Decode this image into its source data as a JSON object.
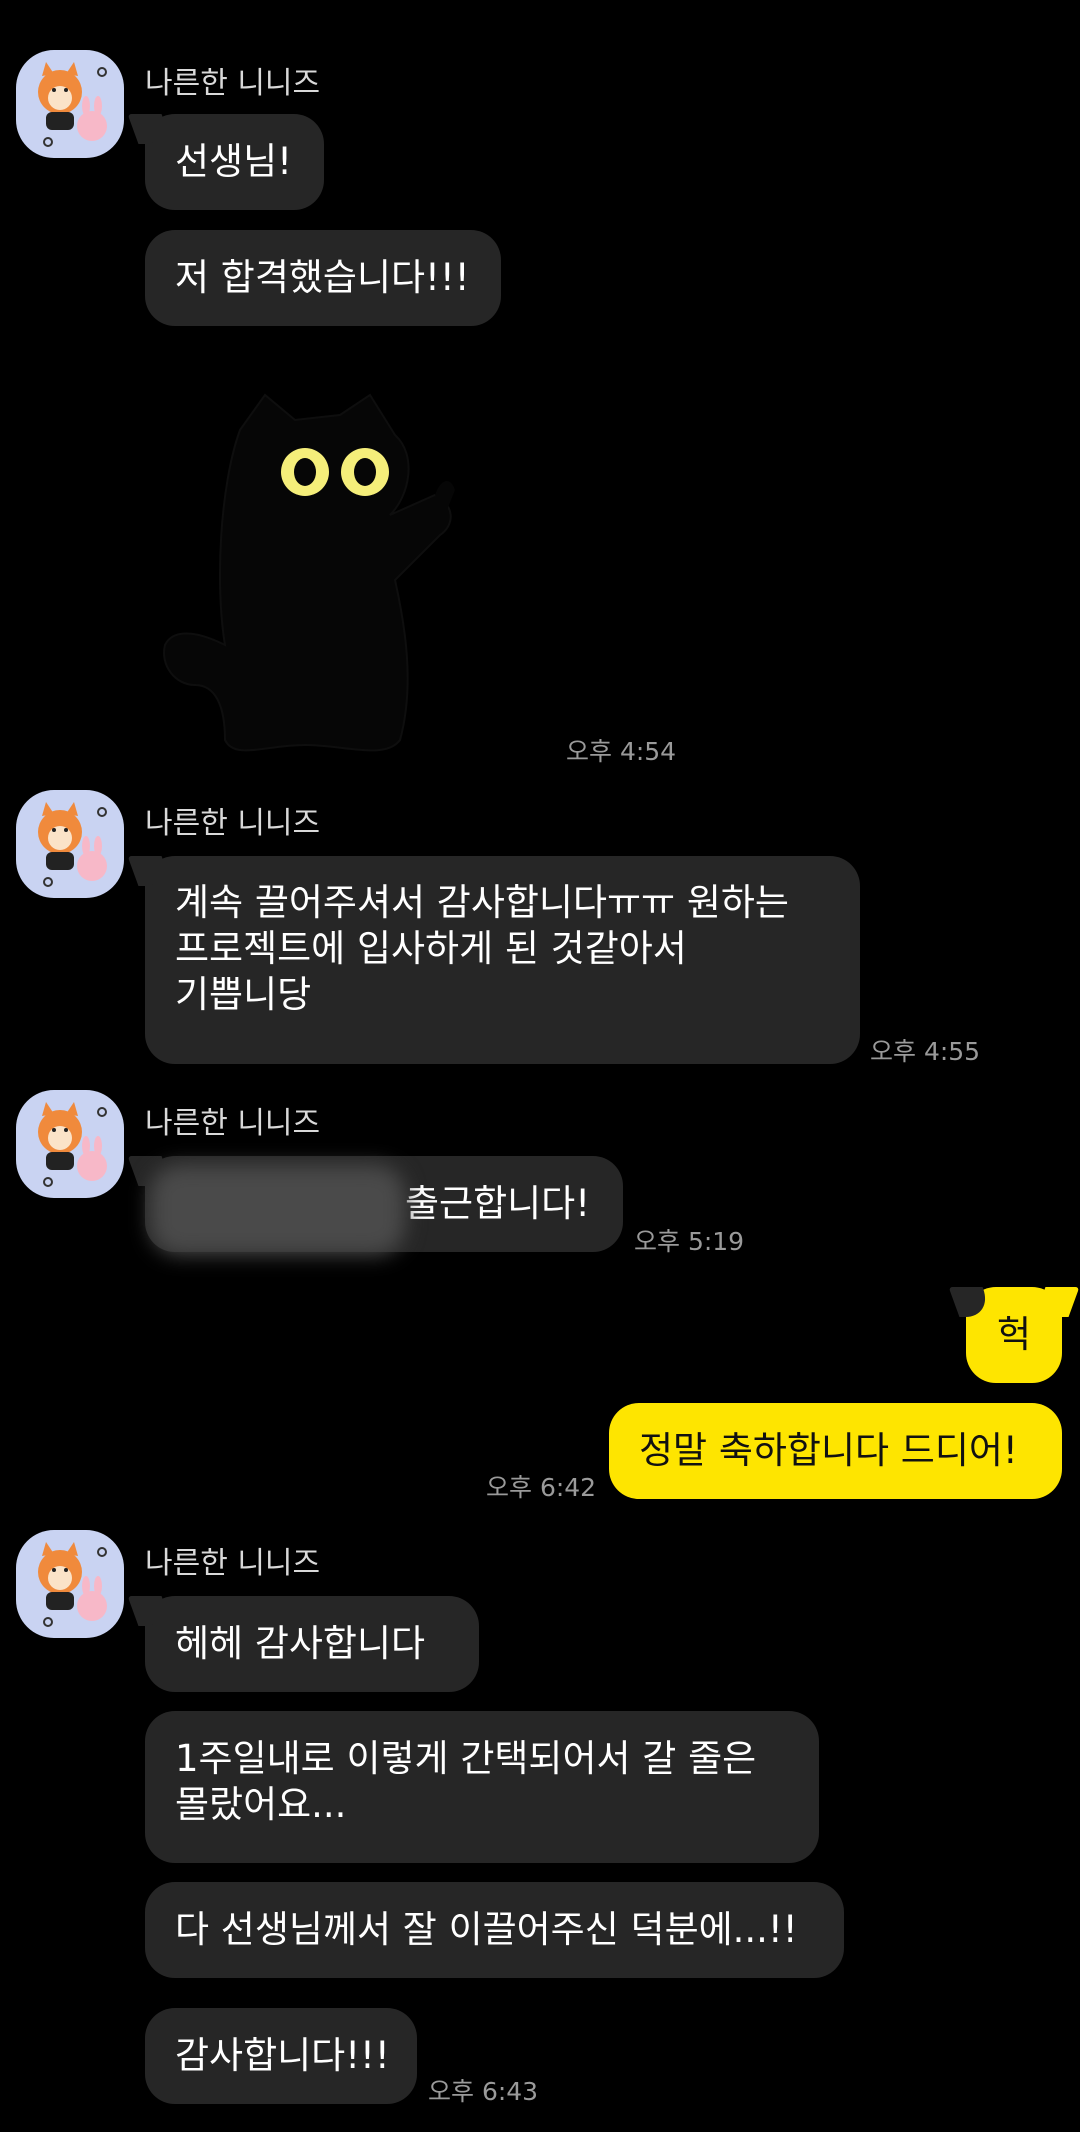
{
  "chat": {
    "sender_name": "나른한 니니즈",
    "groups": [
      {
        "messages": [
          "선생님!",
          "저 합격했습니다!!!"
        ],
        "sticker": "black-cat-sticker",
        "time": "오후 4:54"
      },
      {
        "messages": [
          [
            "계속 끌어주셔서 감사합니다ㅠㅠ 원하는",
            "프로젝트에 입사하게 된 것같아서",
            "기쁩니당"
          ]
        ],
        "time": "오후 4:55"
      },
      {
        "messages": [
          "출근합니다!"
        ],
        "time": "오후 5:19"
      },
      {
        "messages": [
          "헉",
          "정말 축하합니다 드디어!"
        ],
        "time": "오후 6:42",
        "mine": true
      },
      {
        "messages": [
          "헤헤 감사합니다",
          [
            "1주일내로 이렇게 간택되어서 갈 줄은",
            "몰랐어요..."
          ],
          "다 선생님께서 잘 이끌어주신 덕분에...!!",
          "감사합니다!!!"
        ],
        "time": "오후 6:43"
      }
    ]
  },
  "colors": {
    "background": "#000000",
    "their_bubble": "#262626",
    "my_bubble": "#fee500",
    "avatar_bg": "#c9d3f2",
    "timestamp": "#9a9a9a"
  },
  "icons": [
    "profile-avatar-icon",
    "black-cat-sticker"
  ]
}
